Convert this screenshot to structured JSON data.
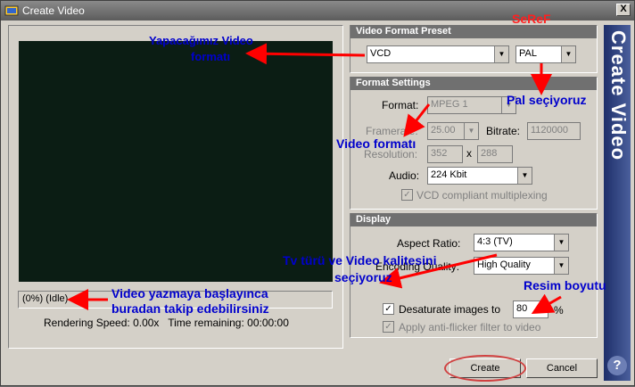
{
  "window": {
    "title": "Create Video",
    "close_label": "X"
  },
  "preview": {
    "progress_text": "(0%) (Idle)",
    "rendering_speed": "Rendering Speed: 0.00x",
    "time_remaining": "Time remaining: 00:00:00"
  },
  "preset": {
    "header": "Video Format Preset",
    "format_value": "VCD",
    "system_value": "PAL"
  },
  "format_settings": {
    "header": "Format Settings",
    "format_label": "Format:",
    "format_value": "MPEG 1",
    "framerate_label": "Framerate:",
    "framerate_value": "25.00",
    "bitrate_label": "Bitrate:",
    "bitrate_value": "1120000",
    "resolution_label": "Resolution:",
    "res_w": "352",
    "res_x": "x",
    "res_h": "288",
    "audio_label": "Audio:",
    "audio_value": "224 Kbit",
    "vcd_label": "VCD compliant multiplexing"
  },
  "display": {
    "header": "Display",
    "aspect_label": "Aspect Ratio:",
    "aspect_value": "4:3 (TV)",
    "quality_label": "Encoding Quality:",
    "quality_value": "High Quality",
    "desat_label": "Desaturate images to",
    "desat_value": "80",
    "percent": "%",
    "flicker_label": "Apply anti-flicker filter to video"
  },
  "buttons": {
    "create": "Create",
    "cancel": "Cancel"
  },
  "sidebar": {
    "title": "Create Video",
    "help": "?"
  },
  "annotations": {
    "seref": "SeReF",
    "format_note_1": "Yapacağımız Video",
    "format_note_2": "formatı",
    "pal_note": "Pal seçiyoruz",
    "video_format_note": "Video formatı",
    "tv_note_1": "Tv türü ve Video kalitesini",
    "tv_note_2": "seçiyoruz",
    "resim_note": "Resim boyutu",
    "progress_note_1": "Video yazmaya başlayınca",
    "progress_note_2": "buradan takip edebilirsiniz"
  }
}
